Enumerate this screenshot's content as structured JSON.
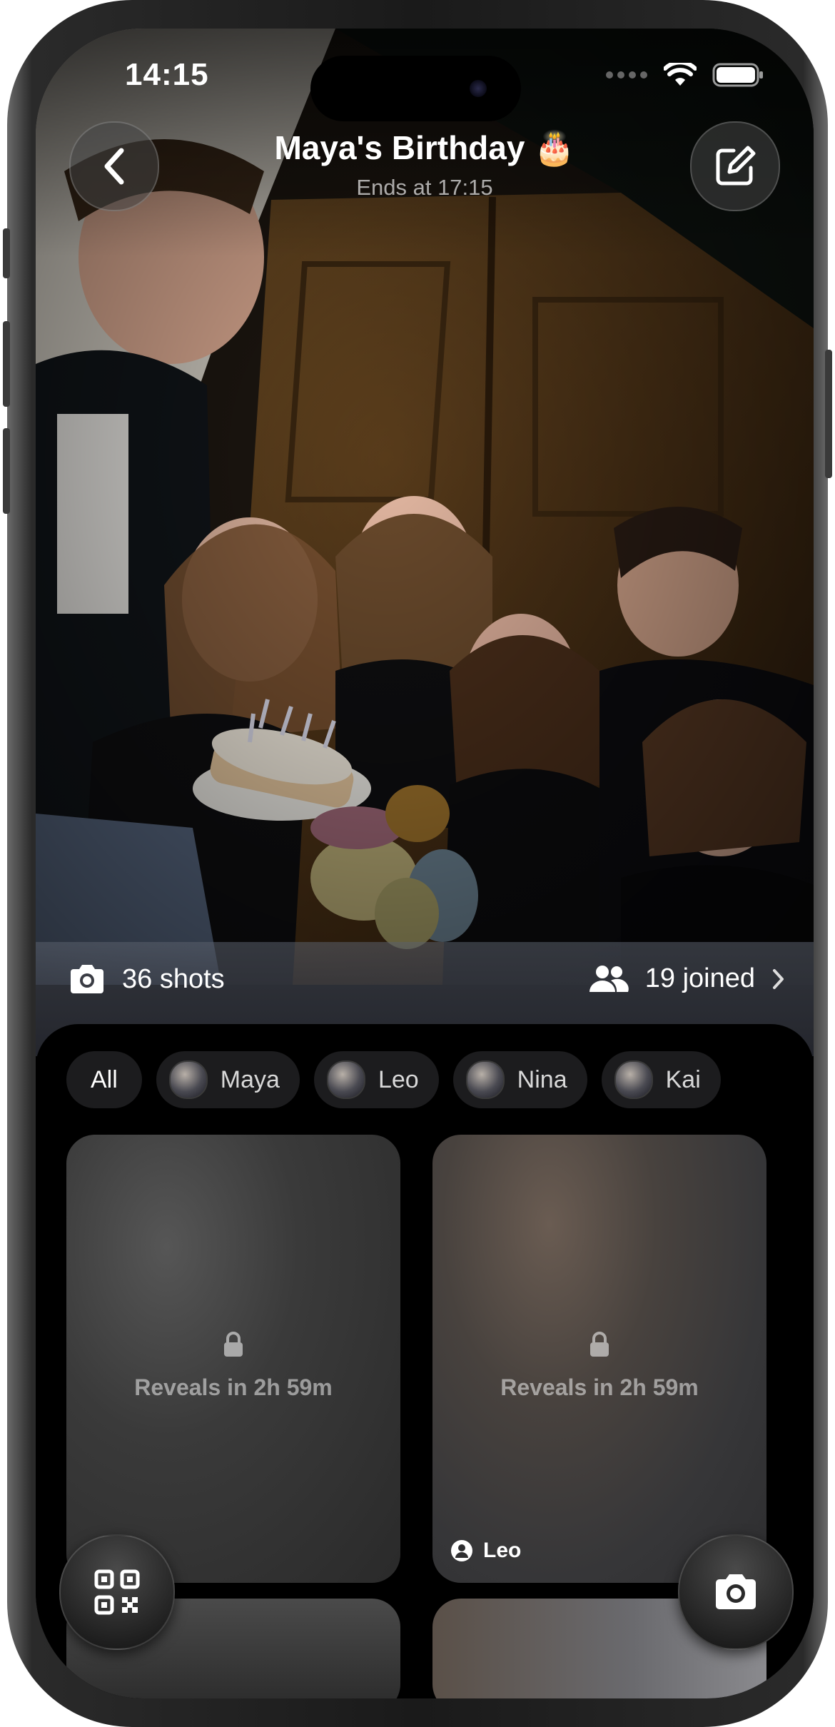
{
  "status_bar": {
    "time": "14:15"
  },
  "header": {
    "back_icon": "chevron-left-icon",
    "title": "Maya's Birthday 🎂",
    "subtitle": "Ends at 17:15",
    "edit_icon": "compose-icon"
  },
  "stats": {
    "shots_label": "36 shots",
    "joined_label": "19 joined"
  },
  "filters": {
    "items": [
      {
        "label": "All",
        "avatar": false,
        "selected": true
      },
      {
        "label": "Maya",
        "avatar": true
      },
      {
        "label": "Leo",
        "avatar": true
      },
      {
        "label": "Nina",
        "avatar": true
      },
      {
        "label": "Kai",
        "avatar": true
      }
    ]
  },
  "gallery": {
    "cards": [
      {
        "reveal_text": "Reveals in 2h 59m",
        "owner": ""
      },
      {
        "reveal_text": "Reveals in 2h 59m",
        "owner": "Leo"
      }
    ]
  },
  "actions": {
    "qr_icon": "qr-code-icon",
    "camera_icon": "camera-icon"
  }
}
